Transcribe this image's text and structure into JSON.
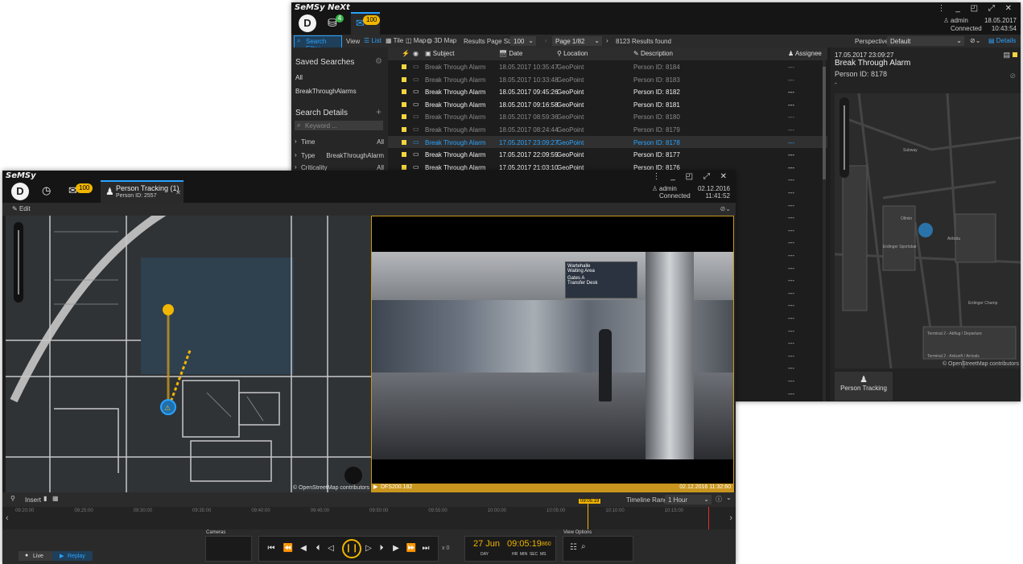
{
  "back": {
    "app_title": "SeMSy NeXt",
    "tab_badge_green": "4",
    "tab_badge_alarm": "100",
    "user": "admin",
    "connection": "Connected",
    "date": "18.05.2017",
    "time": "10:43:54",
    "toolbar": {
      "search_filter": "Search Filter",
      "view": "View",
      "list": "List",
      "tile": "Tile",
      "map": "Map",
      "map3d": "3D Map",
      "page_size_label": "Results Page Size",
      "page_size": "100",
      "page": "Page 1/82",
      "results": "8123 Results found",
      "perspective_label": "Perspective",
      "perspective": "Default",
      "details": "Details"
    },
    "sidebar": {
      "saved_searches": "Saved Searches",
      "items": [
        "All",
        "BreakThroughAlarms"
      ],
      "search_details": "Search Details",
      "keyword_placeholder": "Keyword ...",
      "filters": [
        {
          "label": "Time",
          "value": "All"
        },
        {
          "label": "Type",
          "value": "BreakThroughAlarm"
        },
        {
          "label": "Criticality",
          "value": "All"
        }
      ]
    },
    "columns": {
      "subject": "Subject",
      "date": "Date",
      "location": "Location",
      "description": "Description",
      "assignee": "Assignee"
    },
    "rows": [
      {
        "subject": "Break Through Alarm",
        "date": "18.05.2017 10:35:47",
        "location": "GeoPoint",
        "description": "Person ID: 8184",
        "assignee": "---",
        "state": "read"
      },
      {
        "subject": "Break Through Alarm",
        "date": "18.05.2017 10:33:48",
        "location": "GeoPoint",
        "description": "Person ID: 8183",
        "assignee": "---",
        "state": "read"
      },
      {
        "subject": "Break Through Alarm",
        "date": "18.05.2017 09:45:26",
        "location": "GeoPoint",
        "description": "Person ID: 8182",
        "assignee": "---",
        "state": "unread"
      },
      {
        "subject": "Break Through Alarm",
        "date": "18.05.2017 09:16:58",
        "location": "GeoPoint",
        "description": "Person ID: 8181",
        "assignee": "---",
        "state": "unread"
      },
      {
        "subject": "Break Through Alarm",
        "date": "18.05.2017 08:59:36",
        "location": "GeoPoint",
        "description": "Person ID: 8180",
        "assignee": "---",
        "state": "read"
      },
      {
        "subject": "Break Through Alarm",
        "date": "18.05.2017 08:24:44",
        "location": "GeoPoint",
        "description": "Person ID: 8179",
        "assignee": "---",
        "state": "read"
      },
      {
        "subject": "Break Through Alarm",
        "date": "17.05.2017 23:09:27",
        "location": "GeoPoint",
        "description": "Person ID: 8178",
        "assignee": "---",
        "state": "selected"
      },
      {
        "subject": "Break Through Alarm",
        "date": "17.05.2017 22:09:59",
        "location": "GeoPoint",
        "description": "Person ID: 8177",
        "assignee": "---",
        "state": "unread"
      },
      {
        "subject": "Break Through Alarm",
        "date": "17.05.2017 21:03:10",
        "location": "GeoPoint",
        "description": "Person ID: 8176",
        "assignee": "---",
        "state": "unread"
      }
    ],
    "dash": "---",
    "details": {
      "date": "17.05.2017 23:09:27",
      "title": "Break Through Alarm",
      "person": "Person ID: 8178",
      "dash": "-",
      "map_labels": [
        "Subway",
        "Ollmin",
        "Erdinger Sportsbar",
        "Airbräu",
        "Erdinger Champ",
        "Terminal 2 - Abflug / Departure",
        "Terminal 2 - Ankunft / Arrivals"
      ],
      "osm_credit": "© OpenStreetMap contributors",
      "action": "Person Tracking"
    }
  },
  "front": {
    "app_title": "SeMSy",
    "alarm_badge": "100",
    "tab_title": "Person Tracking (1)",
    "tab_sub": "Person ID: 2557",
    "user": "admin",
    "connection": "Connected",
    "date": "02.12.2016",
    "time": "11:41:52",
    "edit": "Edit",
    "osm_credit": "© OpenStreetMap contributors",
    "camera_name": "DFS200.182",
    "camera_timestamp": "02.12.2016  11:32:60",
    "camera_signs": [
      "Wartehalle",
      "Waiting Area",
      "Gates A",
      "Transfer Desk"
    ],
    "insert": "Insert",
    "timeline_range_label": "Timeline Range",
    "timeline_range": "1 Hour",
    "timeline_marker": "09:05:19",
    "timeline_ticks": [
      "09:20:00",
      "09:25:00",
      "09:30:00",
      "09:35:00",
      "09:40:00",
      "09:45:00",
      "09:50:00",
      "09:55:00",
      "10:00:00",
      "10:05:00",
      "10:10:00",
      "10:15:00"
    ],
    "cameras_label": "Cameras",
    "view_options_label": "View Options",
    "speed": "x 0",
    "play_date": "27 Jun",
    "play_day": "DAY",
    "play_time": "09:05:19",
    "play_ms": ".860",
    "play_units": "HR  MIN  SEC  MS",
    "live": "Live",
    "replay": "Replay"
  }
}
